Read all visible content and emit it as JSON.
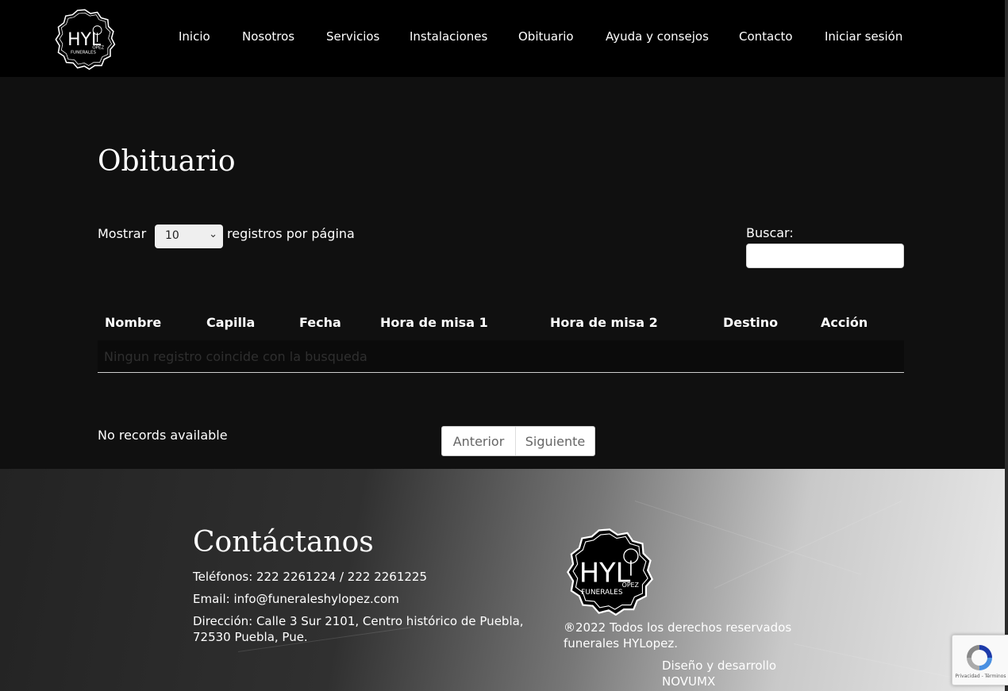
{
  "header": {
    "logo": {
      "main": "HYL",
      "sub": "ÓPEZ",
      "tag": "FUNERALES"
    },
    "nav": [
      "Inicio",
      "Nosotros",
      "Servicios",
      "Instalaciones",
      "Obituario",
      "Ayuda y consejos",
      "Contacto",
      "Iniciar sesión"
    ]
  },
  "main": {
    "title": "Obituario",
    "show_label": "Mostrar",
    "page_size": "10",
    "per_page_label": "registros por página",
    "search_label": "Buscar:",
    "search_value": "",
    "columns": [
      "Nombre",
      "Capilla",
      "Fecha",
      "Hora de misa 1",
      "Hora de misa 2",
      "Destino",
      "Acción"
    ],
    "empty_message": "Ningun registro coincide con la busqueda",
    "records_info": "No records available",
    "pager": {
      "prev": "Anterior",
      "next": "Siguiente"
    }
  },
  "footer": {
    "contact_title": "Contáctanos",
    "phones": "Teléfonos: 222 2261224 / 222 2261225",
    "email": "Email: info@funeraleshylopez.com",
    "address_line1": "Dirección: Calle 3 Sur 2101, Centro histórico de Puebla,",
    "address_line2": "72530 Puebla, Pue.",
    "copyright_line1": "®2022 Todos los derechos reservados",
    "copyright_line2": "funerales HYLopez.",
    "design_line1": "Diseño y desarrollo",
    "design_line2": "NOVUMX"
  },
  "recaptcha": {
    "text": "Privacidad - Términos"
  },
  "colors": {
    "header_bg": "#000000",
    "page_bg": "#101010",
    "text": "#ffffff",
    "pager_text": "#666666"
  }
}
